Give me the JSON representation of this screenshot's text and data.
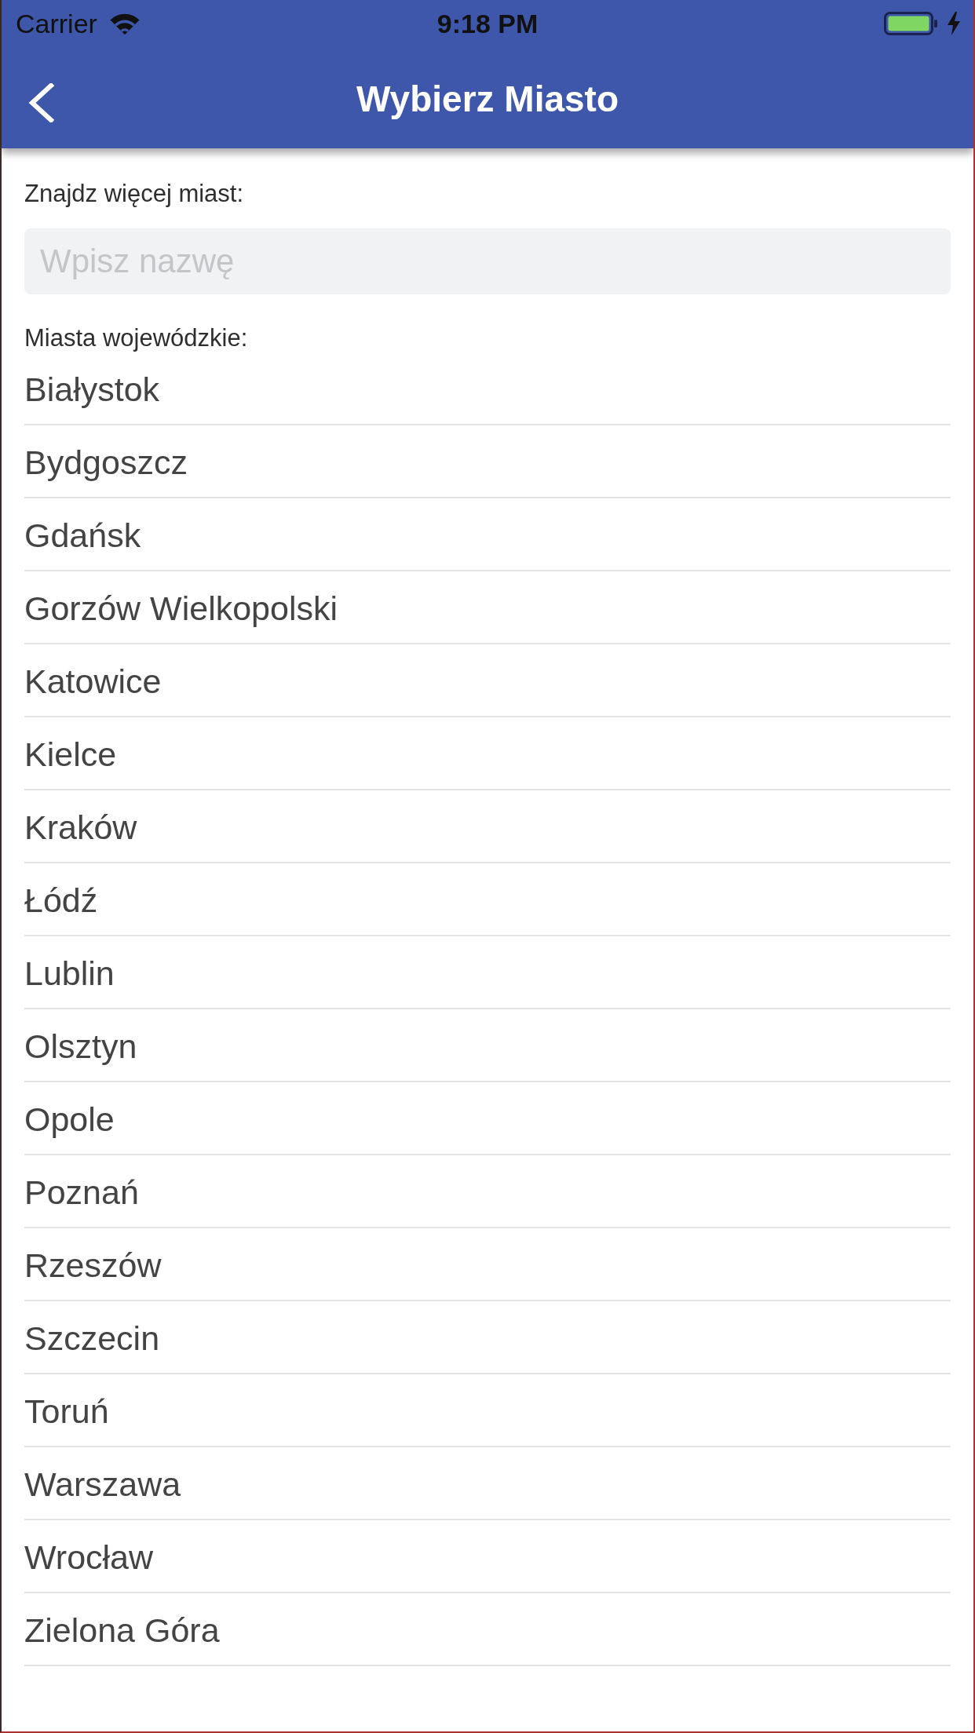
{
  "status_bar": {
    "carrier": "Carrier",
    "time": "9:18 PM"
  },
  "nav_bar": {
    "title": "Wybierz Miasto"
  },
  "search": {
    "label": "Znajdz więcej miast:",
    "placeholder": "Wpisz nazwę"
  },
  "section": {
    "label": "Miasta wojewódzkie:",
    "cities": [
      "Białystok",
      "Bydgoszcz",
      "Gdańsk",
      "Gorzów Wielkopolski",
      "Katowice",
      "Kielce",
      "Kraków",
      "Łódź",
      "Lublin",
      "Olsztyn",
      "Opole",
      "Poznań",
      "Rzeszów",
      "Szczecin",
      "Toruń",
      "Warszawa",
      "Wrocław",
      "Zielona Góra"
    ]
  }
}
